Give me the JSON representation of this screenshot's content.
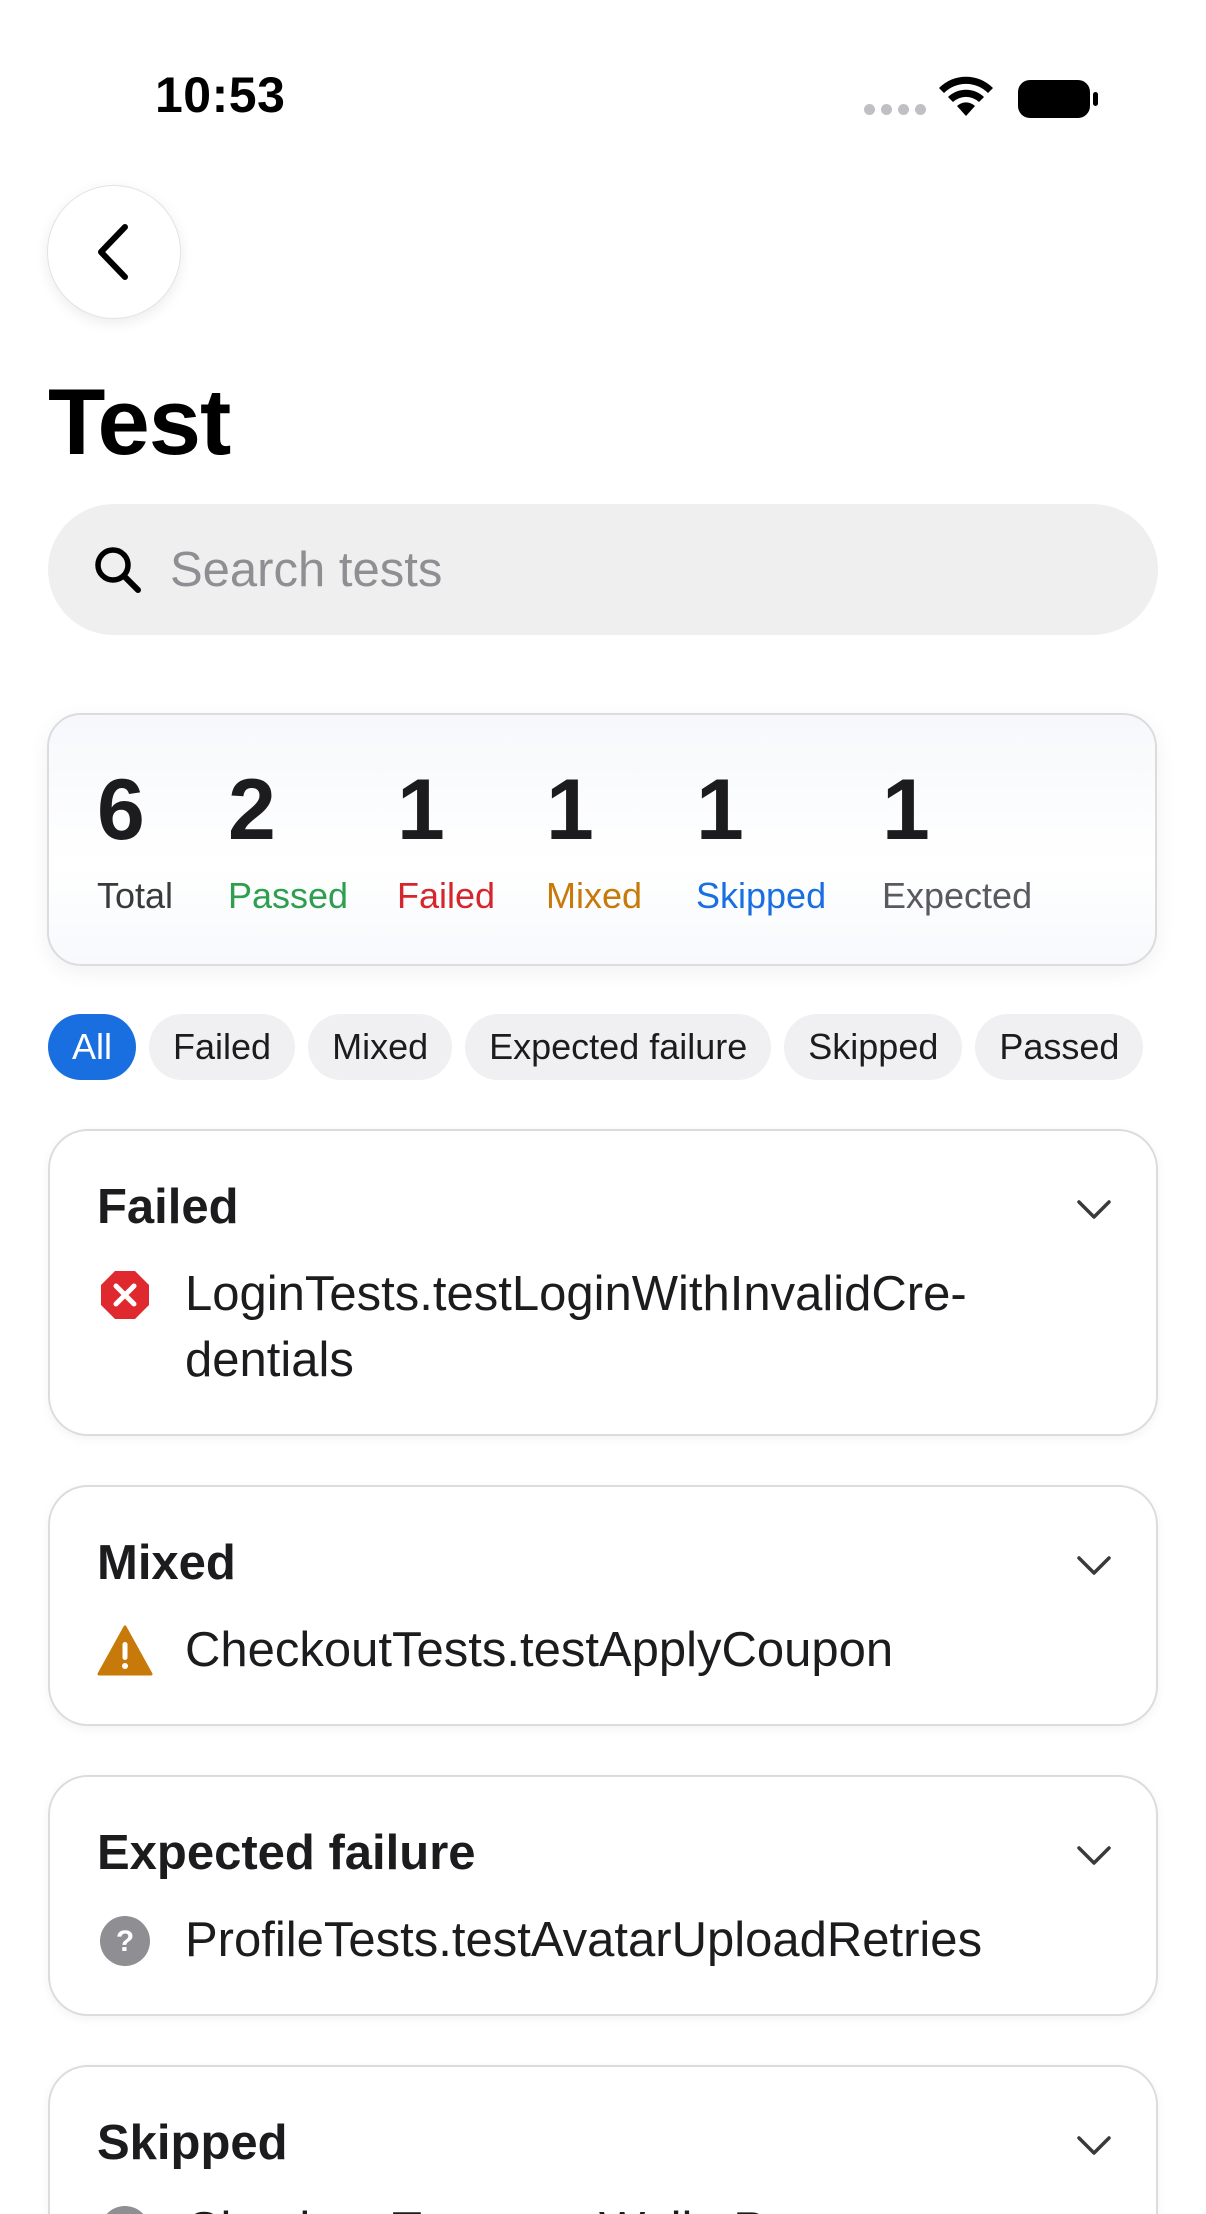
{
  "status_bar": {
    "time": "10:53"
  },
  "header": {
    "title": "Test"
  },
  "search": {
    "placeholder": "Search tests",
    "value": ""
  },
  "summary": {
    "total": {
      "count": "6",
      "label": "Total",
      "color": "#3a3a3c"
    },
    "passed": {
      "count": "2",
      "label": "Passed",
      "color": "#2e9e4f"
    },
    "failed": {
      "count": "1",
      "label": "Failed",
      "color": "#d6262d"
    },
    "mixed": {
      "count": "1",
      "label": "Mixed",
      "color": "#c77a0a"
    },
    "skipped": {
      "count": "1",
      "label": "Skipped",
      "color": "#1a6fe0"
    },
    "expected": {
      "count": "1",
      "label": "Expected",
      "color": "#5a5a5e"
    }
  },
  "filters": {
    "selected": "All",
    "chips": [
      "All",
      "Failed",
      "Mixed",
      "Expected failure",
      "Skipped",
      "Passed"
    ]
  },
  "sections": [
    {
      "title": "Failed",
      "icon": "x-circle-icon",
      "icon_color": "#e0292f",
      "tests": [
        "LoginTests.testLoginWithInvalidCre-\ndentials"
      ]
    },
    {
      "title": "Mixed",
      "icon": "warning-triangle-icon",
      "icon_color": "#c77a0a",
      "tests": [
        "CheckoutTests.testApplyCoupon"
      ]
    },
    {
      "title": "Expected failure",
      "icon": "question-circle-icon",
      "icon_color": "#8e8e93",
      "tests": [
        "ProfileTests.testAvatarUploadRetries"
      ]
    },
    {
      "title": "Skipped",
      "icon": "skip-circle-icon",
      "icon_color": "#8e8e93",
      "tests": [
        "CheckoutTests.testWalletPayment"
      ]
    }
  ]
}
